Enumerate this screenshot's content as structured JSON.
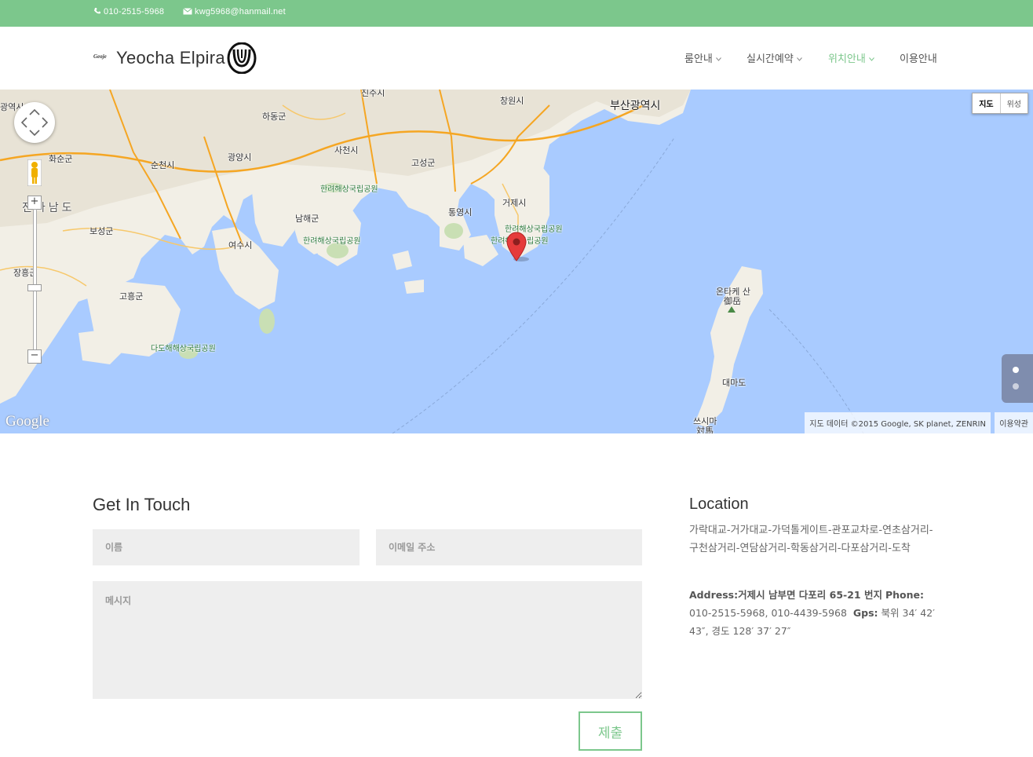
{
  "topbar": {
    "phone": "010-2515-5968",
    "email": "kwg5968@hanmail.net",
    "phone_icon": "phone-icon",
    "email_icon": "envelope-icon",
    "background_color": "#7cc78c"
  },
  "header": {
    "logo_small": "Geoje",
    "logo_text": "Yeocha Elpira",
    "nav": [
      {
        "label": "룸안내",
        "active": false
      },
      {
        "label": "실시간예약",
        "active": false
      },
      {
        "label": "위치안내",
        "active": true
      },
      {
        "label": "이용안내",
        "active": false
      }
    ],
    "accent_color": "#7cc78c"
  },
  "map": {
    "type_buttons": [
      "지도",
      "위성"
    ],
    "selected_type": "지도",
    "labels": {
      "busan": "부산광역시",
      "changwon": "창원시",
      "hadong": "하동군",
      "hwasun": "화순군",
      "suncheon": "순천시",
      "gwangyang": "광양시",
      "sacheon": "사천시",
      "goseong": "고성군",
      "geoje": "거제시",
      "tongyeong": "통영시",
      "namhae": "남해군",
      "yeosu": "여수시",
      "boseong": "보성군",
      "jangheung": "장흥군",
      "goheung": "고흥군",
      "jeonnam": "전라남도",
      "park1": "한려해상국립공원",
      "park2": "한려해상국립공원",
      "park3": "한려해상국립공원",
      "park4": "한려해상국립공원",
      "dado": "다도해해상국립공원",
      "otake": "온타케 산",
      "otake_kanji": "御岳",
      "daemado": "대마도",
      "tsushima": "쓰시마",
      "tsushima_kanji": "対馬",
      "gwangyeok": "광역시",
      "jinju": "진주시"
    },
    "google_logo": "Google",
    "attribution": "지도 데이터 ©2015 Google, SK planet, ZENRIN",
    "terms": "이용약관",
    "sea_color": "#a9cbff"
  },
  "contact": {
    "title": "Get In Touch",
    "name_placeholder": "이름",
    "email_placeholder": "이메일 주소",
    "message_placeholder": "메시지",
    "submit_label": "제출"
  },
  "location": {
    "title": "Location",
    "route": "가락대교-거가대교-가덕톨게이트-관포교차로-연초삼거리-구천삼거리-연담삼거리-학동삼거리-다포삼거리-도착",
    "address_label": "Address:",
    "address_value": "거제시 남부면 다포리 65-21 번지",
    "phone_label": "Phone:",
    "phone_value": "010-2515-5968, 010-4439-5968",
    "gps_label": "Gps:",
    "gps_value": "북위 34′ 42′ 43″, 경도 128′ 37′ 27″"
  }
}
